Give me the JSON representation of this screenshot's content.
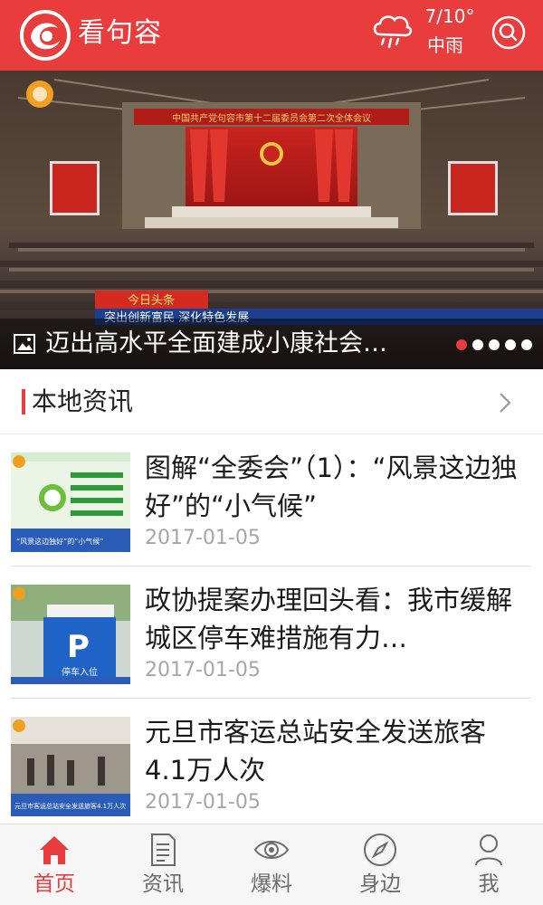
{
  "header": {
    "app_title": "看句容",
    "weather": {
      "temperature": "7/10°",
      "condition": "中雨",
      "icon": "rain-cloud-icon"
    },
    "search_icon": "search-icon"
  },
  "banner": {
    "caption": "迈出高水平全面建成小康社会…",
    "caption_icon": "image-icon",
    "slide_count": 5,
    "active_slide": 1,
    "scene_texts": {
      "stage_banner": "中国共产党句容市第十二届委员会第二次全体会议",
      "headline_tag": "今日头条",
      "ticker": "突出创新富民 深化特色发展"
    }
  },
  "section": {
    "title": "本地资讯",
    "more_icon": "chevron-right-icon"
  },
  "news": [
    {
      "title": "图解“全委会”（1）：“风景这边独好”的“小气候”",
      "date": "2017-01-05",
      "thumb_text": "“风景这边独好”的“小气候”"
    },
    {
      "title": "政协提案办理回头看：我市缓解城区停车难措施有力…",
      "date": "2017-01-05",
      "thumb_text": "停车入位"
    },
    {
      "title": "元旦市客运总站安全发送旅客4.1万人次",
      "date": "2017-01-05",
      "thumb_text": "元旦市客运总站安全发送旅客4.1万人次"
    }
  ],
  "tabs": [
    {
      "label": "首页",
      "icon": "home-icon",
      "active": true
    },
    {
      "label": "资讯",
      "icon": "document-icon",
      "active": false
    },
    {
      "label": "爆料",
      "icon": "eye-icon",
      "active": false
    },
    {
      "label": "身边",
      "icon": "compass-icon",
      "active": false
    },
    {
      "label": "我",
      "icon": "user-icon",
      "active": false
    }
  ],
  "colors": {
    "brand_red": "#e93c3d",
    "tab_inactive": "#6a6a6a",
    "date_gray": "#a6a6a6"
  }
}
